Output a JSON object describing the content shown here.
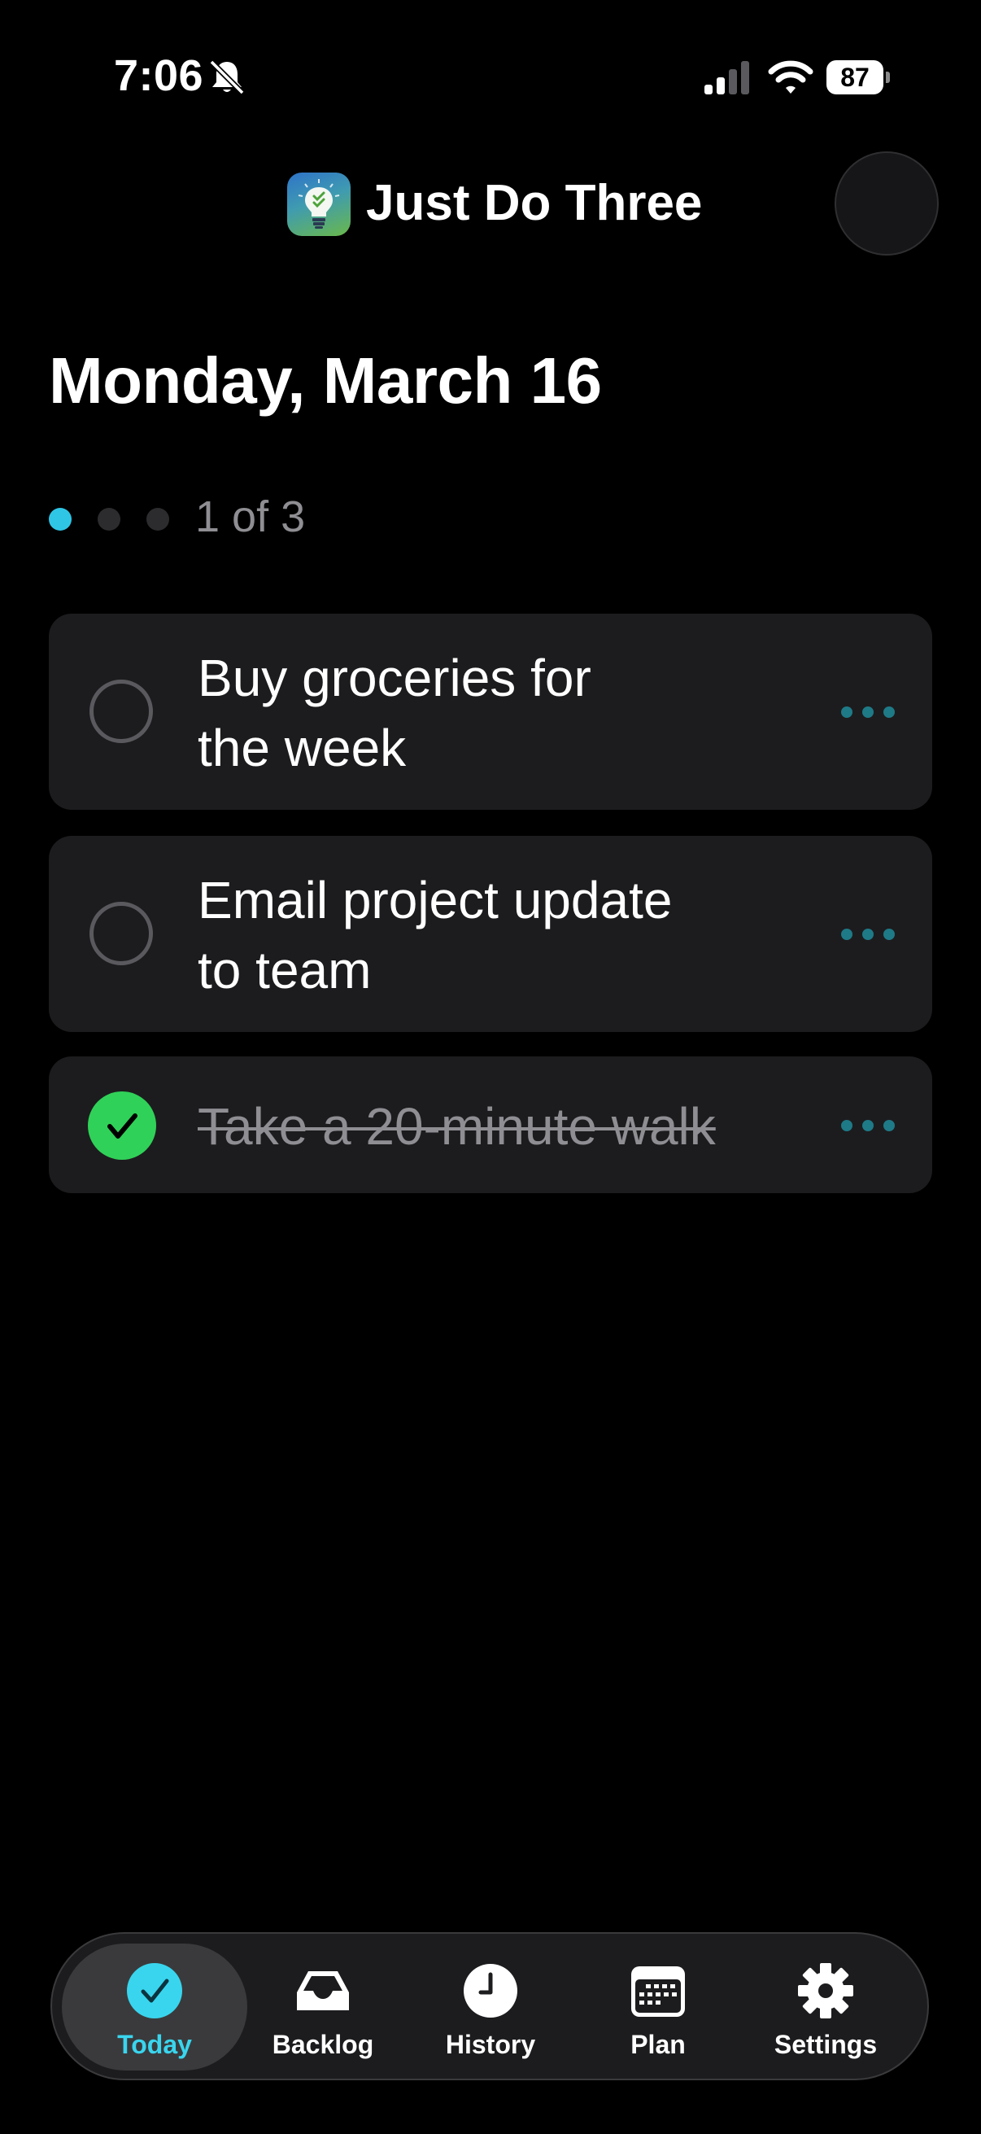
{
  "status_bar": {
    "time": "7:06",
    "battery": "87",
    "icons": [
      "bell-slash-icon",
      "signal-icon",
      "wifi-icon",
      "battery-icon"
    ]
  },
  "header": {
    "app_title": "Just Do Three",
    "app_icon": "lightbulb-checklist-logo",
    "avatar": "profile-avatar"
  },
  "date_title": "Monday, March 16",
  "progress": {
    "label": "1 of 3",
    "completed": 1,
    "total": 3,
    "accent_color": "#2fc6e6"
  },
  "tasks": [
    {
      "line1": "Buy groceries for",
      "line2": "the week",
      "done": false
    },
    {
      "line1": "Email project update",
      "line2": "to team",
      "done": false
    },
    {
      "text": "Take a 20-minute walk",
      "done": true
    }
  ],
  "tabs": [
    {
      "label": "Today",
      "icon": "checkmark-circle-icon",
      "active": true
    },
    {
      "label": "Backlog",
      "icon": "tray-icon",
      "active": false
    },
    {
      "label": "History",
      "icon": "clock-icon",
      "active": false
    },
    {
      "label": "Plan",
      "icon": "calendar-icon",
      "active": false
    },
    {
      "label": "Settings",
      "icon": "gear-icon",
      "active": false
    }
  ],
  "colors": {
    "background": "#000000",
    "card": "#1c1c1e",
    "accent": "#39d5ee",
    "done_green": "#30d158",
    "more_dots": "#1e7a87"
  }
}
